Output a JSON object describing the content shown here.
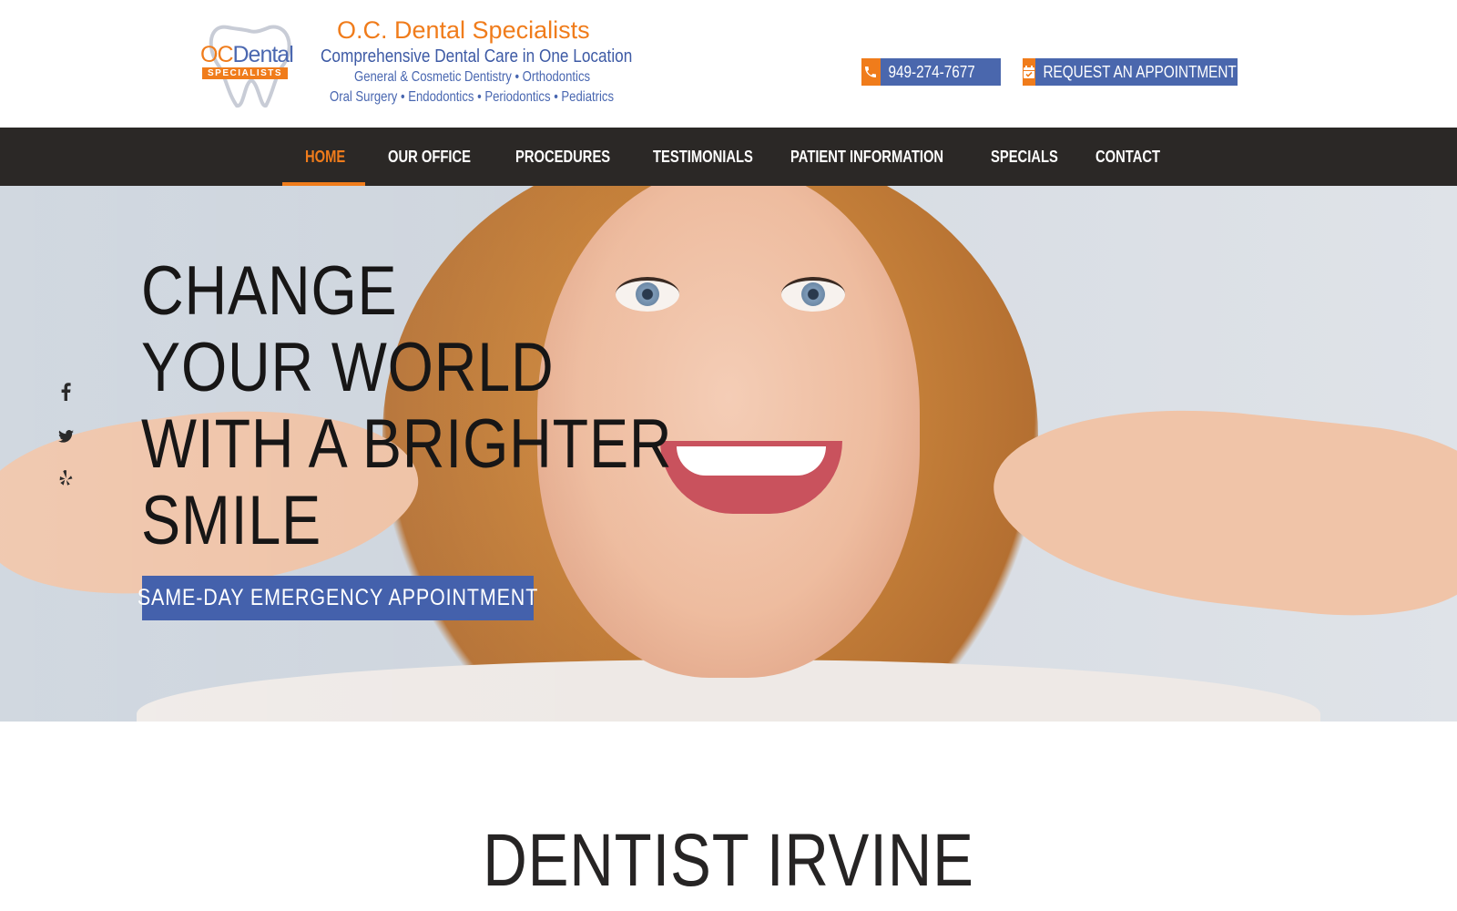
{
  "brand": {
    "mark_oc": "OC",
    "mark_dental": "Dental",
    "mark_badge": "SPECIALISTS",
    "name": "O.C. Dental Specialists",
    "tagline": "Comprehensive Dental Care in One Location",
    "services_line1": "General & Cosmetic Dentistry • Orthodontics",
    "services_line2": "Oral Surgery • Endodontics • Periodontics • Pediatrics"
  },
  "header": {
    "phone": "949-274-7677",
    "phone_icon": "phone-icon",
    "appointment": "REQUEST AN APPOINTMENT!",
    "appointment_icon": "calendar-icon"
  },
  "nav": {
    "items": [
      {
        "label": "HOME",
        "active": true
      },
      {
        "label": "OUR OFFICE"
      },
      {
        "label": "PROCEDURES"
      },
      {
        "label": "TESTIMONIALS"
      },
      {
        "label": "PATIENT INFORMATION"
      },
      {
        "label": "SPECIALS"
      },
      {
        "label": "CONTACT"
      }
    ]
  },
  "hero": {
    "title_lines": [
      "CHANGE",
      "YOUR WORLD",
      "WITH A BRIGHTER",
      "SMILE"
    ],
    "button": "SAME-DAY EMERGENCY APPOINTMENT"
  },
  "social": [
    "facebook-icon",
    "twitter-icon",
    "yelp-icon"
  ],
  "section": {
    "title": "DENTIST IRVINE"
  },
  "colors": {
    "accent": "#f07c1b",
    "brand_blue": "#4461ac",
    "nav_bg": "#2b2826"
  }
}
